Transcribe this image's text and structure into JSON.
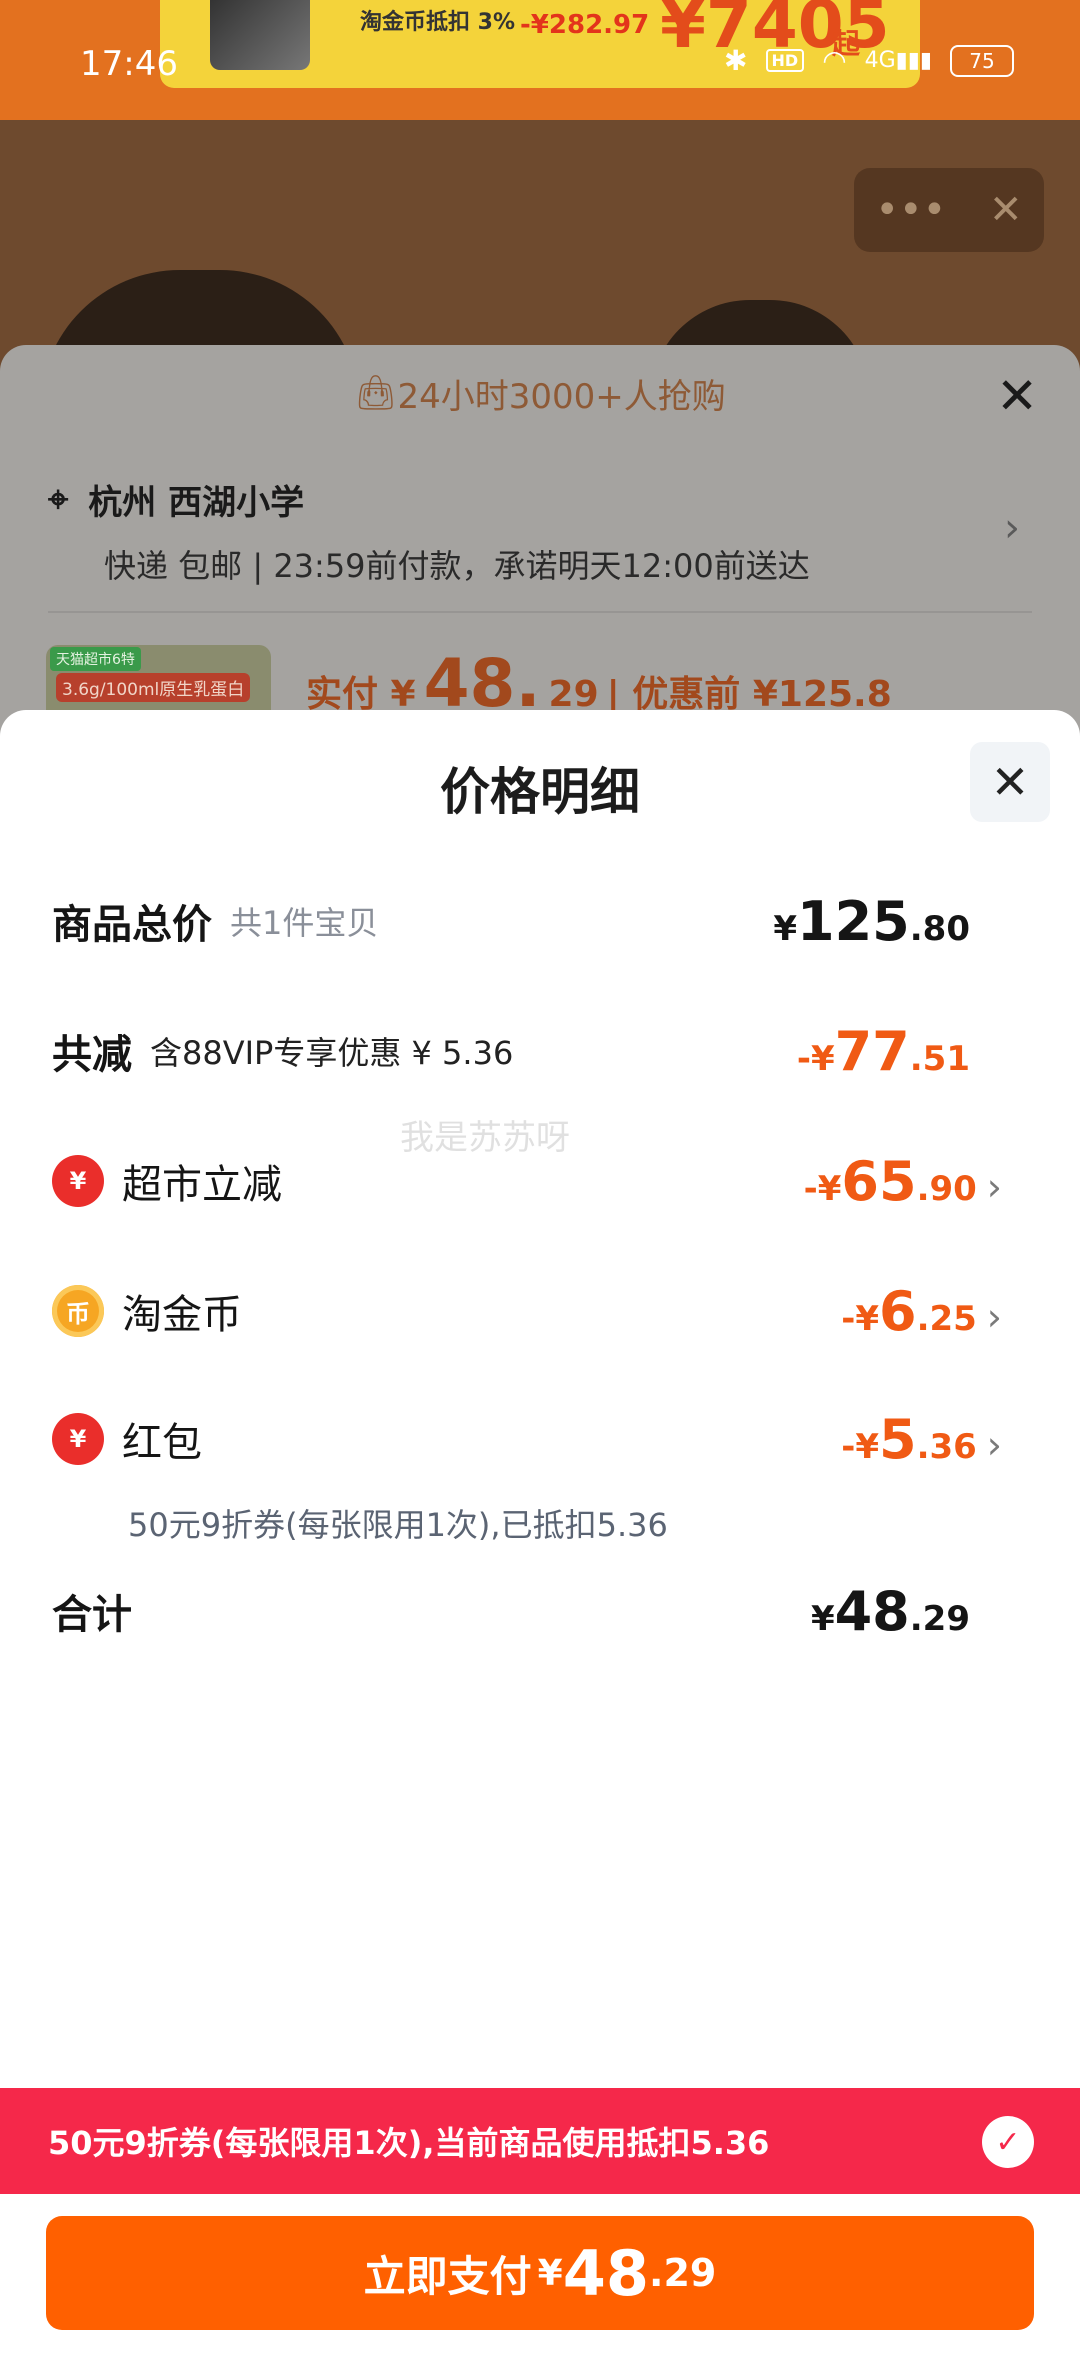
{
  "status_bar": {
    "time": "17:46",
    "battery": "75",
    "network": "4G",
    "hd": "HD"
  },
  "top_banner": {
    "line1": "淘金币抵扣 3%",
    "line2": "-¥282.97",
    "big_price": "¥7405",
    "suffix": "起"
  },
  "background_sheet": {
    "promo_banner": "24小时3000+人抢购",
    "location": "杭州 西湖小学",
    "delivery_method": "快递 包邮",
    "delivery_promise": "23:59前付款，承诺明天12:00前送达",
    "product_badge": "天猫超市6特",
    "product_thumb_text": "3.6g/100ml原生乳蛋白",
    "paid_label": "实付 ¥",
    "paid_int": "48.",
    "paid_dec": "29",
    "before_discount": "| 优惠前 ¥125.8"
  },
  "price_detail": {
    "title": "价格明细",
    "total": {
      "label": "商品总价",
      "sub": "共1件宝贝",
      "yen": "¥",
      "int": "125",
      "dec": ".80"
    },
    "reduction": {
      "label": "共减",
      "note": "含88VIP专享优惠 ¥ 5.36",
      "prefix": "-¥",
      "int": "77",
      "dec": ".51"
    },
    "items": [
      {
        "label": "超市立减",
        "icon": "supermarket-discount-icon",
        "prefix": "-¥",
        "int": "65",
        "dec": ".90"
      },
      {
        "label": "淘金币",
        "icon": "taojinbi-coin-icon",
        "prefix": "-¥",
        "int": "6",
        "dec": ".25"
      },
      {
        "label": "红包",
        "icon": "red-packet-icon",
        "prefix": "-¥",
        "int": "5",
        "dec": ".36",
        "note": "50元9折券(每张限用1次),已抵扣5.36"
      }
    ],
    "sum": {
      "label": "合计",
      "yen": "¥",
      "int": "48",
      "dec": ".29"
    }
  },
  "watermark": "我是苏苏呀",
  "coupon_notice": "50元9折券(每张限用1次),当前商品使用抵扣5.36",
  "pay_button": {
    "label": "立即支付",
    "yen": "¥",
    "int": "48",
    "dec": ".29"
  },
  "colors": {
    "accent_orange": "#ff6000",
    "discount_orange": "#f05a14",
    "notice_red": "#f5284a"
  }
}
